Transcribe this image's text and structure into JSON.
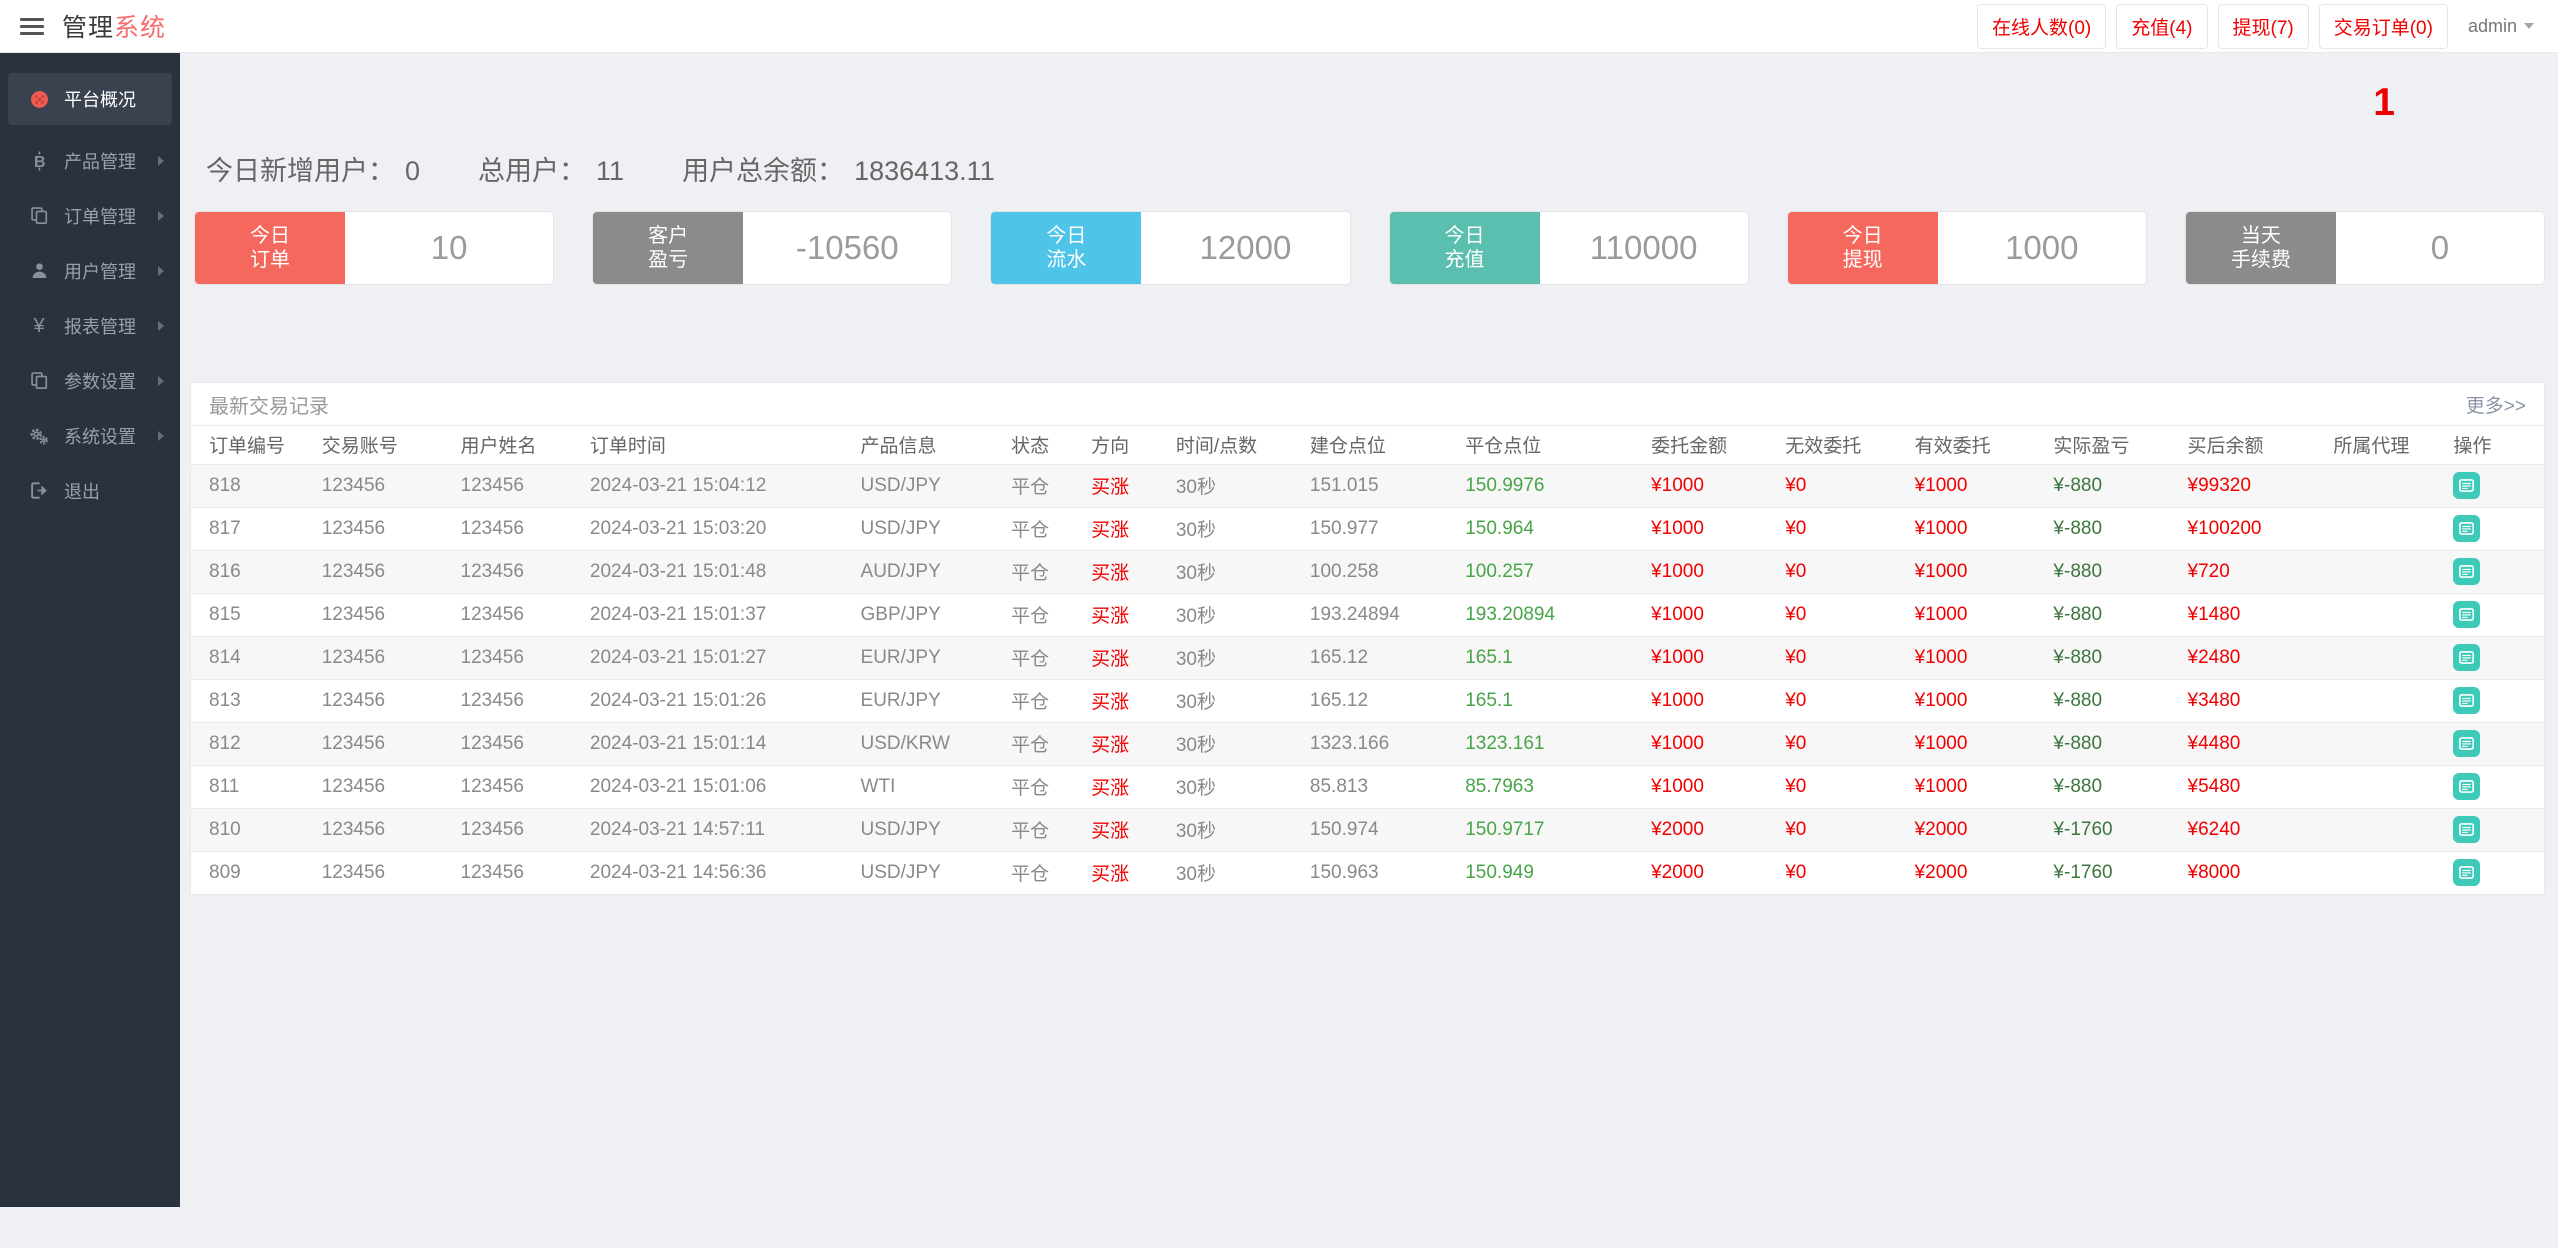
{
  "header": {
    "brand": {
      "part1": "管理",
      "part2": "系统"
    },
    "quick_links": [
      {
        "key": "online-users",
        "label": "在线人数(0)"
      },
      {
        "key": "recharge",
        "label": "充值(4)"
      },
      {
        "key": "withdraw",
        "label": "提现(7)"
      },
      {
        "key": "trade-orders",
        "label": "交易订单(0)"
      }
    ],
    "user_menu": {
      "label": "admin"
    }
  },
  "sidebar": {
    "items": [
      {
        "key": "overview",
        "label": "平台概况",
        "icon": "dashboard-icon",
        "active": true,
        "has_submenu": false
      },
      {
        "key": "products",
        "label": "产品管理",
        "icon": "bitcoin-icon",
        "active": false,
        "has_submenu": true
      },
      {
        "key": "orders",
        "label": "订单管理",
        "icon": "orders-icon",
        "active": false,
        "has_submenu": true
      },
      {
        "key": "users",
        "label": "用户管理",
        "icon": "user-icon",
        "active": false,
        "has_submenu": true
      },
      {
        "key": "reports",
        "label": "报表管理",
        "icon": "yen-icon",
        "active": false,
        "has_submenu": true
      },
      {
        "key": "params",
        "label": "参数设置",
        "icon": "params-icon",
        "active": false,
        "has_submenu": true
      },
      {
        "key": "system",
        "label": "系统设置",
        "icon": "gears-icon",
        "active": false,
        "has_submenu": true
      },
      {
        "key": "logout",
        "label": "退出",
        "icon": "logout-icon",
        "active": false,
        "has_submenu": false
      }
    ]
  },
  "overview": {
    "notification_badge": "1",
    "stats": [
      {
        "key": "new-users-today",
        "label": "今日新增用户：",
        "value": "0"
      },
      {
        "key": "total-users",
        "label": "总用户：",
        "value": "11"
      },
      {
        "key": "total-balance",
        "label": "用户总余额：",
        "value": "1836413.11"
      }
    ],
    "cards": [
      {
        "key": "today-orders",
        "label_line1": "今日",
        "label_line2": "订单",
        "value": "10",
        "color": "#f4685e"
      },
      {
        "key": "customer-pnl",
        "label_line1": "客户",
        "label_line2": "盈亏",
        "value": "-10560",
        "color": "#8b8b8b"
      },
      {
        "key": "today-flow",
        "label_line1": "今日",
        "label_line2": "流水",
        "value": "12000",
        "color": "#4fc4e9"
      },
      {
        "key": "today-recharge",
        "label_line1": "今日",
        "label_line2": "充值",
        "value": "110000",
        "color": "#5abfae"
      },
      {
        "key": "today-withdraw",
        "label_line1": "今日",
        "label_line2": "提现",
        "value": "1000",
        "color": "#f4685e"
      },
      {
        "key": "today-fee",
        "label_line1": "当天",
        "label_line2": "手续费",
        "value": "0",
        "color": "#8b8b8b"
      }
    ]
  },
  "trades_panel": {
    "title": "最新交易记录",
    "more_link": "更多>>",
    "columns": [
      "订单编号",
      "交易账号",
      "用户姓名",
      "订单时间",
      "产品信息",
      "状态",
      "方向",
      "时间/点数",
      "建仓点位",
      "平仓点位",
      "委托金额",
      "无效委托",
      "有效委托",
      "实际盈亏",
      "买后余额",
      "所属代理",
      "操作"
    ],
    "rows": [
      {
        "order_no": "818",
        "account": "123456",
        "name": "123456",
        "time": "2024-03-21 15:04:12",
        "product": "USD/JPY",
        "status": "平仓",
        "direction": "买涨",
        "duration": "30秒",
        "open": "151.015",
        "close": "150.9976",
        "amount": "¥1000",
        "invalid": "¥0",
        "valid": "¥1000",
        "pnl": "¥-880",
        "balance": "¥99320",
        "agent": ""
      },
      {
        "order_no": "817",
        "account": "123456",
        "name": "123456",
        "time": "2024-03-21 15:03:20",
        "product": "USD/JPY",
        "status": "平仓",
        "direction": "买涨",
        "duration": "30秒",
        "open": "150.977",
        "close": "150.964",
        "amount": "¥1000",
        "invalid": "¥0",
        "valid": "¥1000",
        "pnl": "¥-880",
        "balance": "¥100200",
        "agent": ""
      },
      {
        "order_no": "816",
        "account": "123456",
        "name": "123456",
        "time": "2024-03-21 15:01:48",
        "product": "AUD/JPY",
        "status": "平仓",
        "direction": "买涨",
        "duration": "30秒",
        "open": "100.258",
        "close": "100.257",
        "amount": "¥1000",
        "invalid": "¥0",
        "valid": "¥1000",
        "pnl": "¥-880",
        "balance": "¥720",
        "agent": ""
      },
      {
        "order_no": "815",
        "account": "123456",
        "name": "123456",
        "time": "2024-03-21 15:01:37",
        "product": "GBP/JPY",
        "status": "平仓",
        "direction": "买涨",
        "duration": "30秒",
        "open": "193.24894",
        "close": "193.20894",
        "amount": "¥1000",
        "invalid": "¥0",
        "valid": "¥1000",
        "pnl": "¥-880",
        "balance": "¥1480",
        "agent": ""
      },
      {
        "order_no": "814",
        "account": "123456",
        "name": "123456",
        "time": "2024-03-21 15:01:27",
        "product": "EUR/JPY",
        "status": "平仓",
        "direction": "买涨",
        "duration": "30秒",
        "open": "165.12",
        "close": "165.1",
        "amount": "¥1000",
        "invalid": "¥0",
        "valid": "¥1000",
        "pnl": "¥-880",
        "balance": "¥2480",
        "agent": ""
      },
      {
        "order_no": "813",
        "account": "123456",
        "name": "123456",
        "time": "2024-03-21 15:01:26",
        "product": "EUR/JPY",
        "status": "平仓",
        "direction": "买涨",
        "duration": "30秒",
        "open": "165.12",
        "close": "165.1",
        "amount": "¥1000",
        "invalid": "¥0",
        "valid": "¥1000",
        "pnl": "¥-880",
        "balance": "¥3480",
        "agent": ""
      },
      {
        "order_no": "812",
        "account": "123456",
        "name": "123456",
        "time": "2024-03-21 15:01:14",
        "product": "USD/KRW",
        "status": "平仓",
        "direction": "买涨",
        "duration": "30秒",
        "open": "1323.166",
        "close": "1323.161",
        "amount": "¥1000",
        "invalid": "¥0",
        "valid": "¥1000",
        "pnl": "¥-880",
        "balance": "¥4480",
        "agent": ""
      },
      {
        "order_no": "811",
        "account": "123456",
        "name": "123456",
        "time": "2024-03-21 15:01:06",
        "product": "WTI",
        "status": "平仓",
        "direction": "买涨",
        "duration": "30秒",
        "open": "85.813",
        "close": "85.7963",
        "amount": "¥1000",
        "invalid": "¥0",
        "valid": "¥1000",
        "pnl": "¥-880",
        "balance": "¥5480",
        "agent": ""
      },
      {
        "order_no": "810",
        "account": "123456",
        "name": "123456",
        "time": "2024-03-21 14:57:11",
        "product": "USD/JPY",
        "status": "平仓",
        "direction": "买涨",
        "duration": "30秒",
        "open": "150.974",
        "close": "150.9717",
        "amount": "¥2000",
        "invalid": "¥0",
        "valid": "¥2000",
        "pnl": "¥-1760",
        "balance": "¥6240",
        "agent": ""
      },
      {
        "order_no": "809",
        "account": "123456",
        "name": "123456",
        "time": "2024-03-21 14:56:36",
        "product": "USD/JPY",
        "status": "平仓",
        "direction": "买涨",
        "duration": "30秒",
        "open": "150.963",
        "close": "150.949",
        "amount": "¥2000",
        "invalid": "¥0",
        "valid": "¥2000",
        "pnl": "¥-1760",
        "balance": "¥8000",
        "agent": ""
      }
    ]
  },
  "colors": {
    "accent_red": "#f20000",
    "brand_red": "#f56c6c",
    "card_red": "#f4685e",
    "card_gray": "#8b8b8b",
    "card_blue": "#4fc4e9",
    "card_teal": "#5abfae",
    "price_green": "#47a447",
    "pnl_green": "#3c763d",
    "action_teal": "#3ecab8",
    "sidebar_bg": "#2b323f"
  }
}
